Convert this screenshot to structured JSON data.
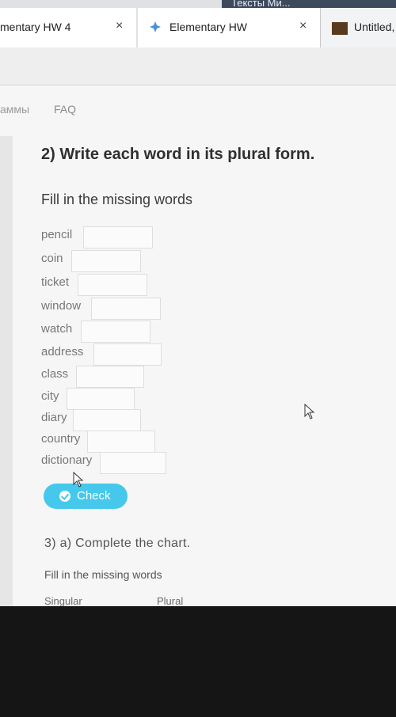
{
  "browser": {
    "tabs": [
      {
        "label": "mentary HW 4",
        "close": "×"
      },
      {
        "label": "Elementary HW",
        "close": "×"
      },
      {
        "label": "Untitled,"
      }
    ],
    "top_strip_text": "Тексты Ми..."
  },
  "nav": {
    "item1": "аммы",
    "item2": "FAQ"
  },
  "exercise2": {
    "title": "2) Write each word in its plural form.",
    "instruction": "Fill in the missing words",
    "words": [
      "pencil",
      "coin",
      "ticket",
      "window",
      "watch",
      "address",
      "class",
      "city",
      "diary",
      "country",
      "dictionary"
    ],
    "check_label": "Check"
  },
  "exercise3": {
    "title": "3) a) Complete the chart.",
    "instruction": "Fill in the missing words",
    "col_singular": "Singular",
    "col_plural": "Plural"
  },
  "colors": {
    "accent": "#45c8ec"
  },
  "icons": {
    "tab2": "spark-icon",
    "tab3": "docs-icon",
    "check": "checkmark-circle-icon",
    "cursor": "mouse-pointer-icon"
  }
}
